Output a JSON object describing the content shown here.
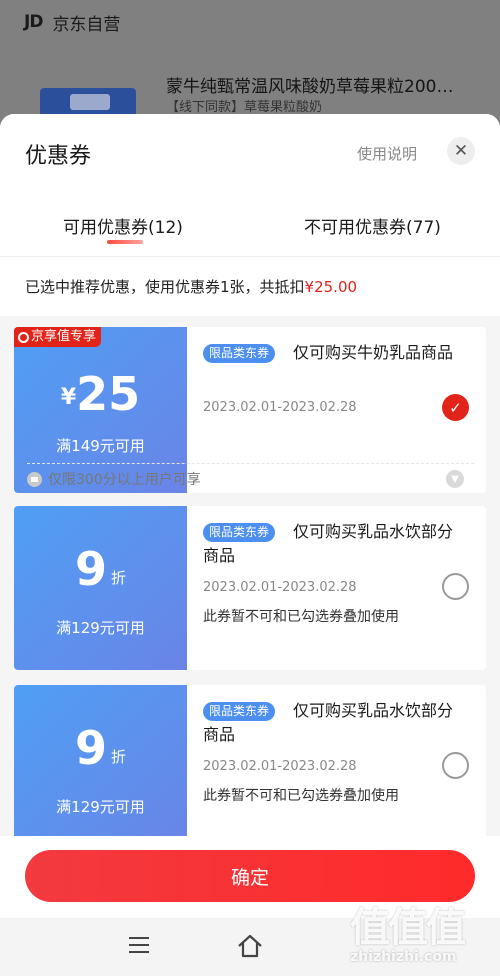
{
  "background": {
    "header_logo": "JD",
    "header_title": "京东自营",
    "product_title": "蒙牛纯甄常温风味酸奶草莓果粒200…",
    "product_subtitle": "【线下同款】草莓果粒酸奶"
  },
  "sheet": {
    "title": "优惠券",
    "help_label": "使用说明",
    "close_icon": "close-icon",
    "tabs": [
      {
        "label": "可用优惠券(12)",
        "active": true
      },
      {
        "label": "不可用优惠券(77)",
        "active": false
      }
    ],
    "summary_text": "已选中推荐优惠，使用优惠券1张，共抵扣",
    "summary_amount": "¥25.00"
  },
  "coupons": [
    {
      "badge": "京享值专享",
      "currency": "¥",
      "value": "25",
      "unit": "",
      "threshold": "满149元可用",
      "tag": "限品类东券",
      "title": "仅可购买牛奶乳品商品",
      "date": "2023.02.01-2023.02.28",
      "selected": true,
      "limit_text": "仅限300分以上用户可享"
    },
    {
      "value": "9",
      "unit": "折",
      "threshold": "满129元可用",
      "tag": "限品类东券",
      "title": "仅可购买乳品水饮部分商品",
      "date": "2023.02.01-2023.02.28",
      "note": "此券暂不可和已勾选券叠加使用",
      "selected": false
    },
    {
      "value": "9",
      "unit": "折",
      "threshold": "满129元可用",
      "tag": "限品类东券",
      "title": "仅可购买乳品水饮部分商品",
      "date": "2023.02.01-2023.02.28",
      "note": "此券暂不可和已勾选券叠加使用",
      "selected": false
    }
  ],
  "confirm_label": "确定",
  "nav": {
    "menu_icon": "menu-icon",
    "home_icon": "home-icon"
  },
  "watermark": {
    "logo": "值值值",
    "url": "zhizhizhi.com"
  },
  "colors": {
    "accent_red": "#e2231a",
    "coupon_blue": "#5a92ee",
    "tag_blue": "#4d8ff0"
  }
}
